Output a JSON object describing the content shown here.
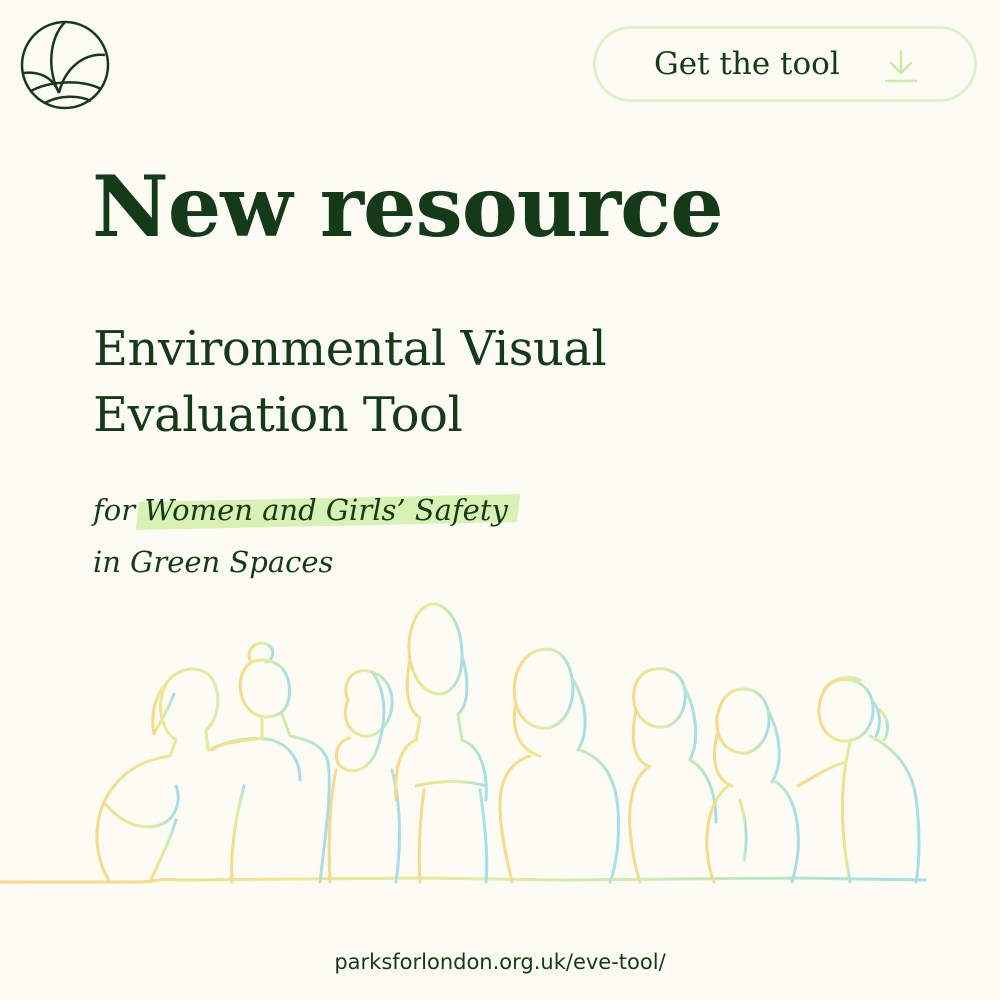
{
  "header": {
    "logo_icon": "leaf-circle-logo-icon",
    "cta": {
      "label": "Get the tool",
      "icon": "download-arrow-icon",
      "border_color": "#dff1c7",
      "icon_color": "#cdeaa8"
    }
  },
  "main": {
    "headline": "New resource",
    "title_lines": [
      "Environmental Visual",
      "Evaluation Tool"
    ],
    "subtitle": {
      "prefix": "for ",
      "highlight": "Women and Girls’ Safety",
      "line2": "in Green Spaces"
    }
  },
  "illustration": {
    "icon": "line-drawing-group-of-women",
    "gradient_colors": [
      "#f7d98a",
      "#f0e98c",
      "#d9efa0",
      "#b8e8c2",
      "#a8dcea"
    ]
  },
  "footer": {
    "url": "parksforlondon.org.uk/eve-tool/"
  },
  "colors": {
    "background": "#fcfcf4",
    "text": "#153a17",
    "highlight": "#d8f2b4"
  }
}
